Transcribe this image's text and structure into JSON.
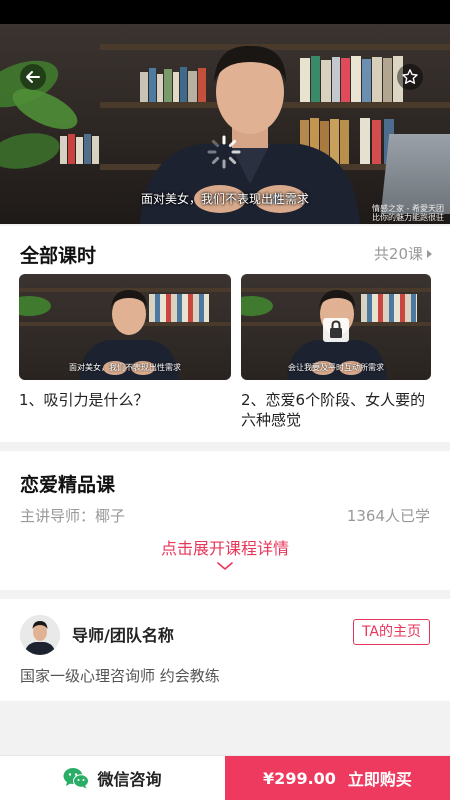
{
  "video": {
    "subtitle": "面对美女，我们不表现出性需求",
    "watermark_line1": "情感之家 - 希愛天团",
    "watermark_line2": "比你的魅力能跑很驻"
  },
  "lessons": {
    "title": "全部课时",
    "total": "共20课",
    "items": [
      {
        "title": "1、吸引力是什么？",
        "thumb_subtitle": "面对美女，我们不表现出性需求",
        "locked": false
      },
      {
        "title": "2、恋爱6个阶段、女人要的六种感觉",
        "thumb_subtitle": "会让我要及平时互动所需求",
        "locked": true
      }
    ]
  },
  "course": {
    "title": "恋爱精品课",
    "teacher_label": "主讲导师：椰子",
    "learners": "1364人已学",
    "expand_label": "点击展开课程详情"
  },
  "teacher": {
    "name": "导师/团队名称",
    "home_button": "TA的主页",
    "description": "国家一级心理咨询师  约会教练"
  },
  "bottom": {
    "consult_label": "微信咨询",
    "price": "¥299.00",
    "buy_label": "立即购买"
  },
  "colors": {
    "accent": "#ee3a5e",
    "text_pink": "#e8365a"
  }
}
